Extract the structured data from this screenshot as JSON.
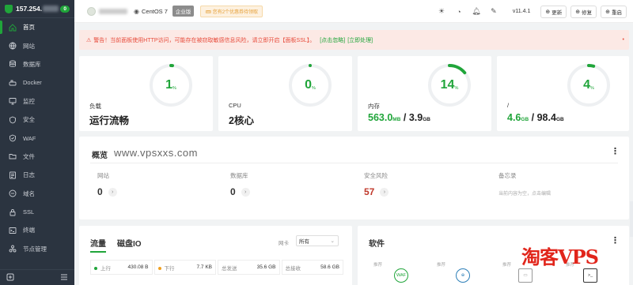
{
  "sidebar": {
    "ip": "157.254.",
    "badge": "0",
    "items": [
      {
        "label": "首页",
        "icon": "home-icon",
        "active": true
      },
      {
        "label": "网站",
        "icon": "globe-icon"
      },
      {
        "label": "数据库",
        "icon": "database-icon"
      },
      {
        "label": "Docker",
        "icon": "docker-icon"
      },
      {
        "label": "监控",
        "icon": "monitor-icon"
      },
      {
        "label": "安全",
        "icon": "shield-icon"
      },
      {
        "label": "WAF",
        "icon": "waf-icon"
      },
      {
        "label": "文件",
        "icon": "folder-icon"
      },
      {
        "label": "日志",
        "icon": "log-icon"
      },
      {
        "label": "域名",
        "icon": "domain-icon"
      },
      {
        "label": "SSL",
        "icon": "ssl-icon"
      },
      {
        "label": "终端",
        "icon": "terminal-icon"
      },
      {
        "label": "节点管理",
        "icon": "node-icon"
      }
    ]
  },
  "topbar": {
    "os": "CentOS 7",
    "edition": "企业版",
    "coupon": "您有2个优惠券待领取",
    "version": "v11.4.1",
    "buttons": [
      "更新",
      "修复",
      "重启"
    ]
  },
  "alert": {
    "text": "警告！当前面板使用HTTP访问，可能存在被窃取敏感信息风险，请立即开启【面板SSL】。",
    "link1": "[点击忽略]",
    "link2": "[立即处理]",
    "close": "•"
  },
  "status": [
    {
      "label": "负载",
      "percent": "1",
      "unit": "%",
      "value_text": "运行流畅",
      "fraction": 0.01
    },
    {
      "label": "CPU",
      "percent": "0",
      "unit": "%",
      "value_text": "2核心",
      "fraction": 0.0
    },
    {
      "label": "内存",
      "percent": "14",
      "unit": "%",
      "used": "563.0",
      "used_unit": "MB",
      "sep": "/",
      "total": "3.9",
      "total_unit": "GB",
      "fraction": 0.14
    },
    {
      "label": "/",
      "percent": "4",
      "unit": "%",
      "used": "4.6",
      "used_unit": "GB",
      "sep": "/",
      "total": "98.4",
      "total_unit": "GB",
      "fraction": 0.04
    }
  ],
  "overview": {
    "title": "概览",
    "watermark": "www.vpsxxs.com",
    "items": [
      {
        "label": "网站",
        "value": "0"
      },
      {
        "label": "数据库",
        "value": "0"
      },
      {
        "label": "安全风险",
        "value": "57"
      },
      {
        "label": "备忘录",
        "sub": "当前内容为空，点击编辑"
      }
    ]
  },
  "flow": {
    "tabs": [
      "流量",
      "磁盘IO"
    ],
    "nic_label": "网卡",
    "nic_value": "所有",
    "stats": [
      {
        "label": "上行",
        "value": "430.08 B",
        "color": "#20a53a"
      },
      {
        "label": "下行",
        "value": "7.7 KB",
        "color": "#f0a020"
      },
      {
        "label": "总发送",
        "value": "35.6 GB"
      },
      {
        "label": "总接收",
        "value": "58.6 GB"
      }
    ]
  },
  "software": {
    "title": "软件",
    "tags": [
      "推荐",
      "推荐",
      "推荐",
      "推荐"
    ],
    "first_icon": "WAF"
  },
  "brand": "淘客VPS"
}
